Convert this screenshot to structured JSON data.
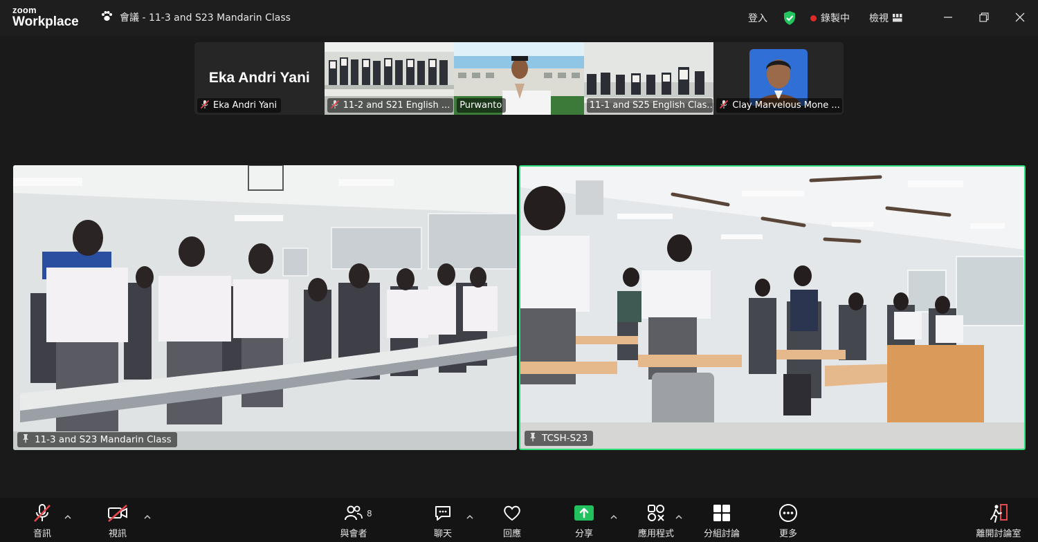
{
  "titlebar": {
    "logo_top": "zoom",
    "logo_bottom": "Workplace",
    "meeting_title": "會議 - 11-3 and S23 Mandarin Class",
    "sign_in": "登入",
    "recording": "錄製中",
    "view": "檢視"
  },
  "thumbnails": [
    {
      "name": "Eka Andri Yani",
      "big_name": "Eka Andri Yani",
      "muted": true
    },
    {
      "name": "11-2 and S21 English ...",
      "muted": true
    },
    {
      "name": "Purwanto",
      "muted": false
    },
    {
      "name": "11-1 and S25 English Clas...",
      "muted": false
    },
    {
      "name": "Clay Marvelous Mone ...",
      "muted": true
    }
  ],
  "panes": {
    "left_name": "11-3 and S23 Mandarin Class",
    "right_name": "TCSH-S23"
  },
  "toolbar": {
    "audio": "音訊",
    "video": "視訊",
    "participants": "與會者",
    "participants_count": "8",
    "chat": "聊天",
    "react": "回應",
    "share": "分享",
    "apps": "應用程式",
    "breakout": "分組討論",
    "more": "更多",
    "leave": "離開討論室"
  },
  "colors": {
    "active_speaker_border": "#2ee07a",
    "share_green": "#21c25e",
    "record_red": "#e02828",
    "shield_green": "#22c55e",
    "mute_red": "#e5484d"
  },
  "icons": [
    "paw-icon",
    "shield-check-icon",
    "record-dot-icon",
    "grid-view-icon",
    "minimize-icon",
    "restore-icon",
    "close-icon",
    "mic-muted-icon",
    "video-off-icon",
    "participants-icon",
    "chat-icon",
    "heart-icon",
    "share-arrow-icon",
    "apps-icon",
    "breakout-icon",
    "more-icon",
    "leave-icon",
    "pin-icon"
  ]
}
